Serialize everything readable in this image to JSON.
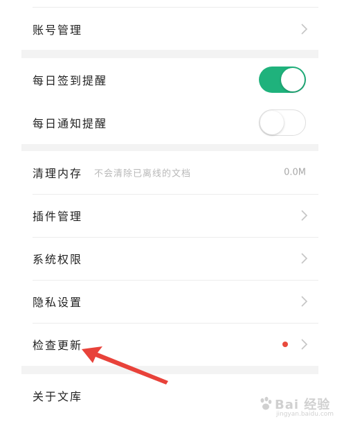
{
  "settings": {
    "account": {
      "label": "账号管理"
    },
    "checkin_reminder": {
      "label": "每日签到提醒",
      "enabled": true
    },
    "notify_reminder": {
      "label": "每日通知提醒",
      "enabled": false
    },
    "clear_cache": {
      "label": "清理内存",
      "hint": "不会清除已离线的文档",
      "value": "0.0M"
    },
    "plugins": {
      "label": "插件管理"
    },
    "permissions": {
      "label": "系统权限"
    },
    "privacy": {
      "label": "隐私设置"
    },
    "check_update": {
      "label": "检查更新",
      "has_badge": true
    },
    "about": {
      "label": "关于文库"
    }
  },
  "icons": {
    "chevron": "chevron-right-icon",
    "badge": "red-dot-icon"
  },
  "colors": {
    "toggle_on": "#1fb27c",
    "badge_red": "#e84a3c",
    "annotation_arrow": "#e8423a"
  },
  "watermark": {
    "brand": "Bai 经验",
    "url": "jingyan.baidu.com"
  }
}
